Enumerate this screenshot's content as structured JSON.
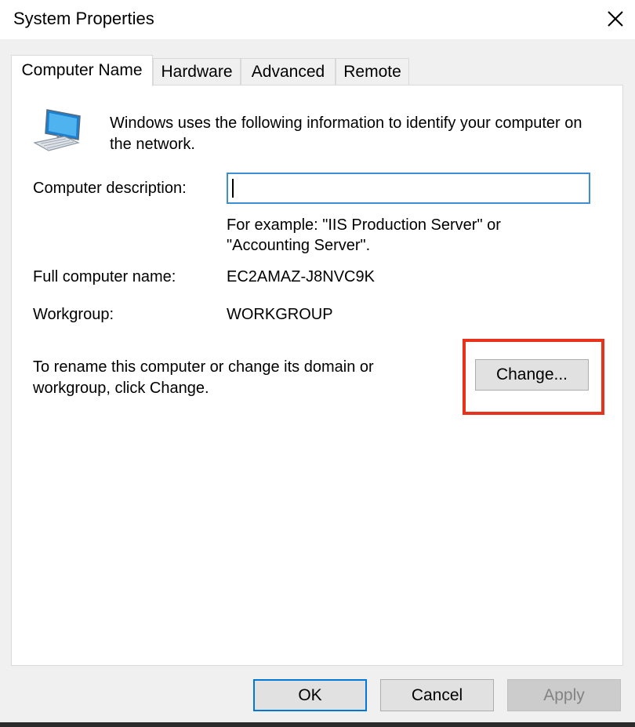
{
  "window": {
    "title": "System Properties"
  },
  "tabs": [
    {
      "label": "Computer Name",
      "active": true
    },
    {
      "label": "Hardware",
      "active": false
    },
    {
      "label": "Advanced",
      "active": false
    },
    {
      "label": "Remote",
      "active": false
    }
  ],
  "computer_name": {
    "intro": "Windows uses the following information to identify your computer on the network.",
    "description_label": "Computer description:",
    "description_value": "",
    "example_text": "For example: \"IIS Production Server\" or \"Accounting Server\".",
    "full_name_label": "Full computer name:",
    "full_name_value": "EC2AMAZ-J8NVC9K",
    "workgroup_label": "Workgroup:",
    "workgroup_value": "WORKGROUP",
    "rename_text": "To rename this computer or change its domain or workgroup, click Change.",
    "change_button": "Change..."
  },
  "footer": {
    "ok_label": "OK",
    "cancel_label": "Cancel",
    "apply_label": "Apply"
  },
  "colors": {
    "highlight": "#e8321c",
    "focus_border": "#3e8ed6",
    "default_button_border": "#0078d7"
  },
  "icons": {
    "computer": "computer-icon",
    "close": "close-icon"
  }
}
